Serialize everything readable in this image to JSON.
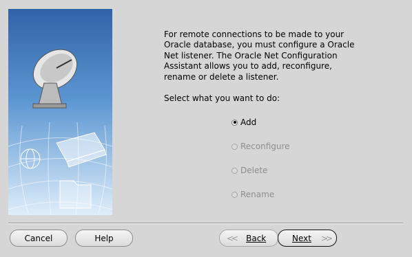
{
  "description": "For remote connections to be made to your\nOracle database, you must configure a Oracle\nNet listener. The Oracle Net Configuration\nAssistant allows you to add, reconfigure,\nrename or delete a listener.",
  "prompt": "Select what you want to do:",
  "options": [
    {
      "label": "Add",
      "selected": true,
      "enabled": true
    },
    {
      "label": "Reconfigure",
      "selected": false,
      "enabled": false
    },
    {
      "label": "Delete",
      "selected": false,
      "enabled": false
    },
    {
      "label": "Rename",
      "selected": false,
      "enabled": false
    }
  ],
  "buttons": {
    "cancel": "Cancel",
    "help": "Help",
    "back": "Back",
    "next": "Next"
  },
  "colors": {
    "sidebar_top": "#2f63a8",
    "sidebar_bottom": "#dfeefa",
    "disabled_text": "#8e8e8e"
  }
}
